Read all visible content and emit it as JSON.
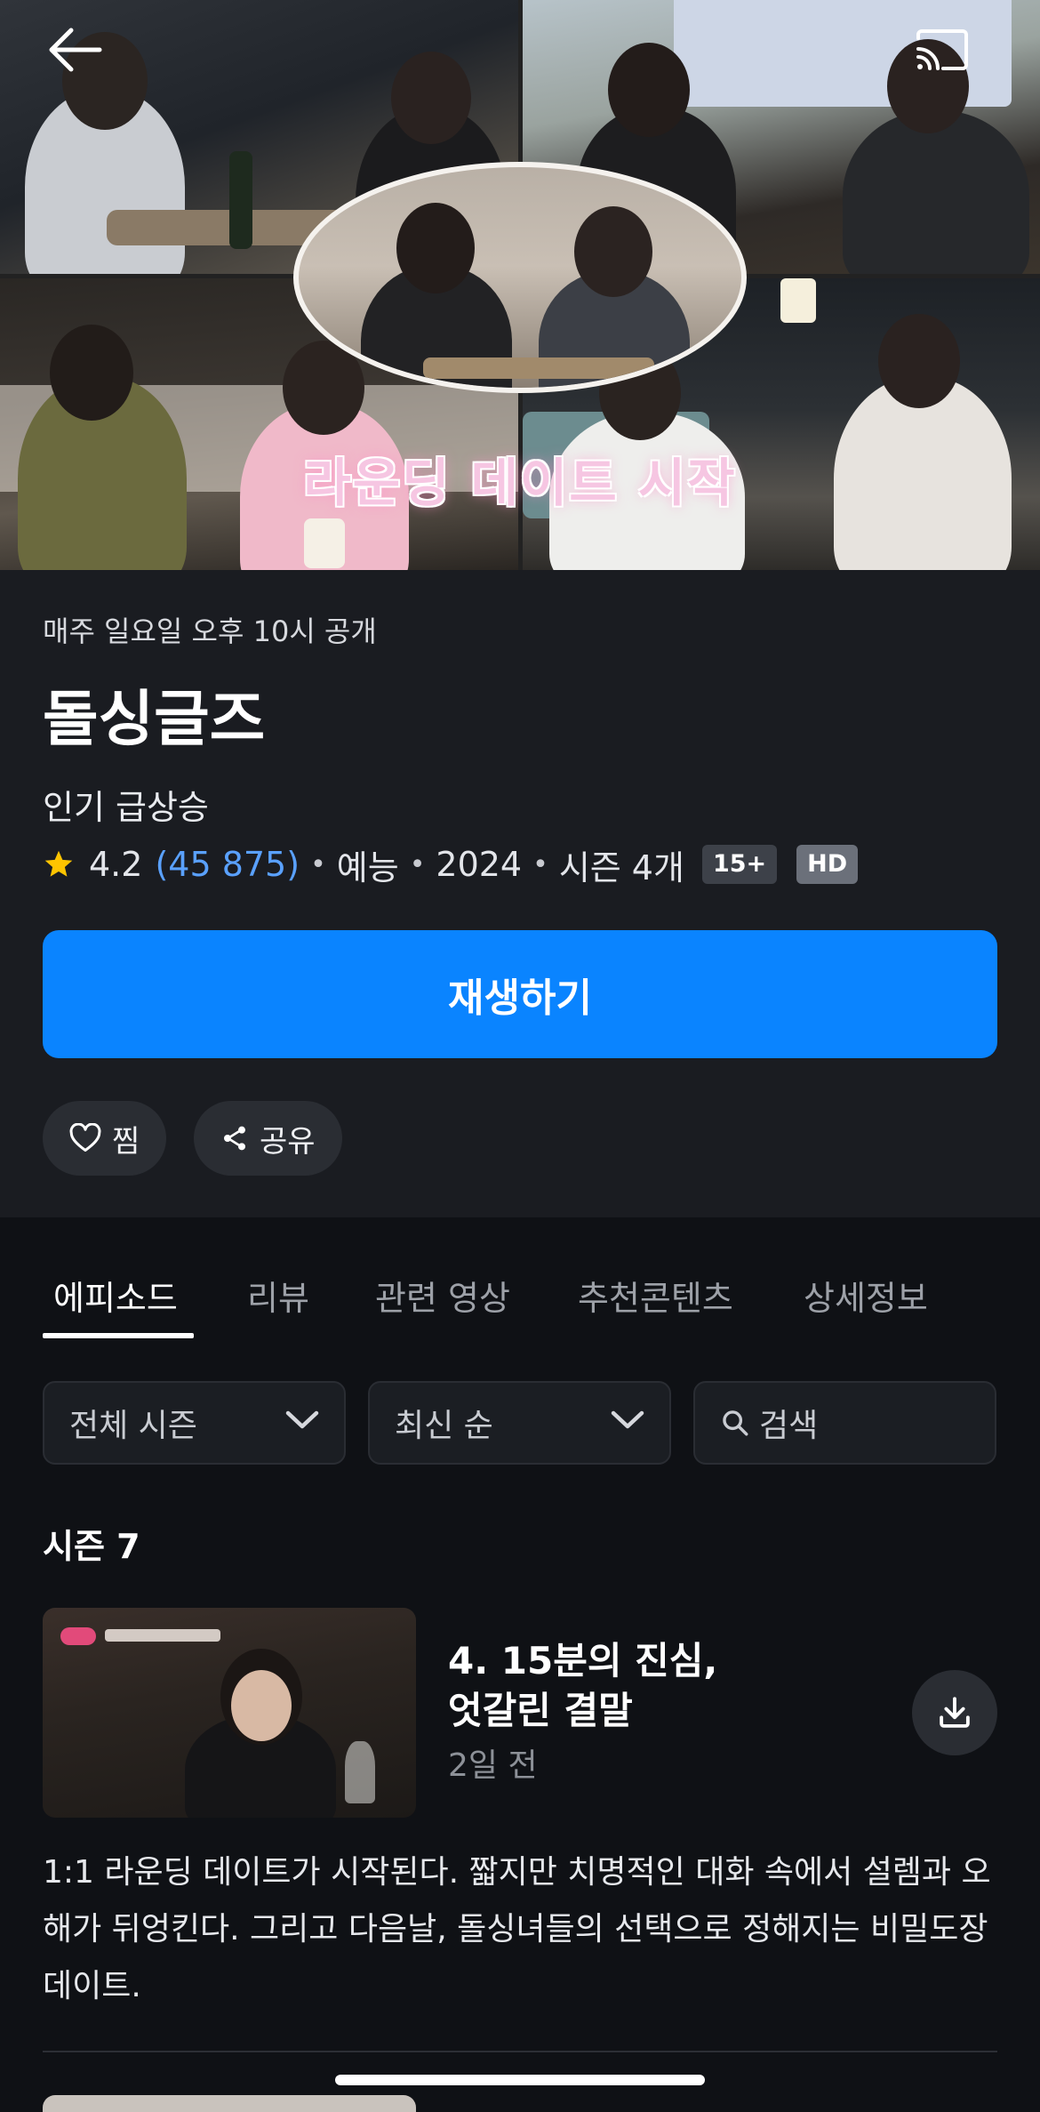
{
  "hero": {
    "caption": "라운딩 데이트 시작",
    "back_icon": "arrow-left-icon",
    "cast_icon": "cast-icon"
  },
  "show": {
    "release_schedule": "매주 일요일 오후 10시 공개",
    "title": "돌싱글즈",
    "trending_label": "인기 급상승",
    "rating": "4.2",
    "rating_count": "(45 875)",
    "genre": "예능",
    "year": "2024",
    "seasons": "시즌 4개",
    "age_badge": "15+",
    "quality_badge": "HD",
    "play_label": "재생하기",
    "like_label": "찜",
    "share_label": "공유"
  },
  "tabs": [
    {
      "label": "에피소드",
      "active": true
    },
    {
      "label": "리뷰",
      "active": false
    },
    {
      "label": "관련 영상",
      "active": false
    },
    {
      "label": "추천콘텐츠",
      "active": false
    },
    {
      "label": "상세정보",
      "active": false
    }
  ],
  "filters": {
    "season_select": "전체 시즌",
    "sort_select": "최신 순",
    "search_placeholder": "검색"
  },
  "season_heading": "시즌 7",
  "episodes": [
    {
      "title_line1": "4. 15분의 진심,",
      "title_line2": "엇갈린 결말",
      "date": "2일 전",
      "description": "1:1 라운딩 데이트가 시작된다. 짧지만 치명적인 대화 속에서 설렘과 오해가 뒤엉킨다. 그리고 다음날, 돌싱녀들의 선택으로 정해지는 비밀도장 데이트."
    }
  ],
  "colors": {
    "accent": "#0a84ff",
    "rating_count": "#5aa1ff",
    "star": "#ffc400",
    "background": "#0f1115",
    "info_background": "#1a1c21"
  }
}
